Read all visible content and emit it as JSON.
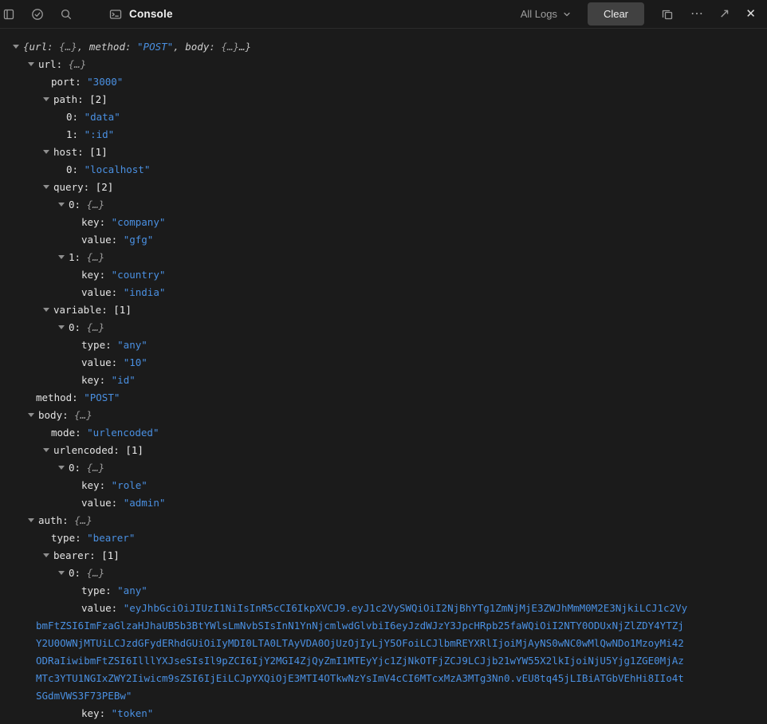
{
  "topbar": {
    "console_label": "Console",
    "filter_label": "All Logs",
    "clear_label": "Clear",
    "icons": {
      "more": "⋯",
      "open": "↗",
      "close": "✕"
    }
  },
  "colors": {
    "background": "#1b1b1b",
    "string_value": "#4a90e2",
    "key_text": "#e3e3e3",
    "muted_text": "#9e9e9e",
    "clear_button_bg": "#414141"
  },
  "tree": {
    "rows": [
      {
        "type": "summary",
        "level": 0,
        "caret": true,
        "parts": [
          {
            "t": "{",
            "c": "p"
          },
          {
            "t": "url",
            "c": "k"
          },
          {
            "t": ": ",
            "c": "p"
          },
          {
            "t": "{…}",
            "c": "o"
          },
          {
            "t": ", ",
            "c": "p"
          },
          {
            "t": "method",
            "c": "k"
          },
          {
            "t": ": ",
            "c": "p"
          },
          {
            "t": "POST",
            "c": "s"
          },
          {
            "t": ", ",
            "c": "p"
          },
          {
            "t": "body",
            "c": "k"
          },
          {
            "t": ": ",
            "c": "p"
          },
          {
            "t": "{…}",
            "c": "o"
          },
          {
            "t": "…}",
            "c": "p"
          }
        ]
      },
      {
        "level": 1,
        "caret": true,
        "key": "url",
        "vt": "obj"
      },
      {
        "level": 2,
        "key": "port",
        "vt": "str",
        "val": "3000"
      },
      {
        "level": 2,
        "caret": true,
        "key": "path",
        "vt": "count",
        "val": 2
      },
      {
        "level": 3,
        "key": "0",
        "vt": "str",
        "val": "data"
      },
      {
        "level": 3,
        "key": "1",
        "vt": "str",
        "val": ":id"
      },
      {
        "level": 2,
        "caret": true,
        "key": "host",
        "vt": "count",
        "val": 1
      },
      {
        "level": 3,
        "key": "0",
        "vt": "str",
        "val": "localhost"
      },
      {
        "level": 2,
        "caret": true,
        "key": "query",
        "vt": "count",
        "val": 2
      },
      {
        "level": 3,
        "caret": true,
        "key": "0",
        "vt": "obj"
      },
      {
        "level": 4,
        "key": "key",
        "vt": "str",
        "val": "company"
      },
      {
        "level": 4,
        "key": "value",
        "vt": "str",
        "val": "gfg"
      },
      {
        "level": 3,
        "caret": true,
        "key": "1",
        "vt": "obj"
      },
      {
        "level": 4,
        "key": "key",
        "vt": "str",
        "val": "country"
      },
      {
        "level": 4,
        "key": "value",
        "vt": "str",
        "val": "india"
      },
      {
        "level": 2,
        "caret": true,
        "key": "variable",
        "vt": "count",
        "val": 1
      },
      {
        "level": 3,
        "caret": true,
        "key": "0",
        "vt": "obj"
      },
      {
        "level": 4,
        "key": "type",
        "vt": "str",
        "val": "any"
      },
      {
        "level": 4,
        "key": "value",
        "vt": "str",
        "val": "10"
      },
      {
        "level": 4,
        "key": "key",
        "vt": "str",
        "val": "id"
      },
      {
        "level": 1,
        "key": "method",
        "vt": "str",
        "val": "POST"
      },
      {
        "level": 1,
        "caret": true,
        "key": "body",
        "vt": "obj"
      },
      {
        "level": 2,
        "key": "mode",
        "vt": "str",
        "val": "urlencoded"
      },
      {
        "level": 2,
        "caret": true,
        "key": "urlencoded",
        "vt": "count",
        "val": 1
      },
      {
        "level": 3,
        "caret": true,
        "key": "0",
        "vt": "obj"
      },
      {
        "level": 4,
        "key": "key",
        "vt": "str",
        "val": "role"
      },
      {
        "level": 4,
        "key": "value",
        "vt": "str",
        "val": "admin"
      },
      {
        "level": 1,
        "caret": true,
        "key": "auth",
        "vt": "obj"
      },
      {
        "level": 2,
        "key": "type",
        "vt": "str",
        "val": "bearer"
      },
      {
        "level": 2,
        "caret": true,
        "key": "bearer",
        "vt": "count",
        "val": 1
      },
      {
        "level": 3,
        "caret": true,
        "key": "0",
        "vt": "obj"
      },
      {
        "level": 4,
        "key": "type",
        "vt": "str",
        "val": "any"
      },
      {
        "level": 4,
        "key": "value",
        "vt": "str",
        "wrap": true,
        "val": "eyJhbGciOiJIUzI1NiIsInR5cCI6IkpXVCJ9.eyJ1c2VySWQiOiI2NjBhYTg1ZmNjMjE3ZWJhMmM0M2E3NjkiLCJ1c2VybmFtZSI6ImFzaGlzaHJhaUB5b3BtYWlsLmNvbSIsInN1YnNjcmlwdGlvbiI6eyJzdWJzY3JpcHRpb25faWQiOiI2NTY0ODUxNjZlZDY4YTZjY2U0OWNjMTUiLCJzdGFydERhdGUiOiIyMDI0LTA0LTAyVDA0OjUzOjIyLjY5OFoiLCJlbmREYXRlIjoiMjAyNS0wNC0wMlQwNDo1MzoyMi42ODRaIiwibmFtZSI6IlllYXJseSIsIl9pZCI6IjY2MGI4ZjQyZmI1MTEyYjc1ZjNkOTFjZCJ9LCJjb21wYW55X2lkIjoiNjU5Yjg1ZGE0MjAzMTc3YTU1NGIxZWY2Iiwicm9sZSI6IjEiLCJpYXQiOjE3MTI4OTkwNzYsImV4cCI6MTcxMzA3MTg3Nn0.vEU8tq45jLIBiATGbVEhHi8IIo4tSGdmVWS3F73PEBw"
      },
      {
        "level": 4,
        "key": "key",
        "vt": "str",
        "val": "token"
      }
    ]
  }
}
